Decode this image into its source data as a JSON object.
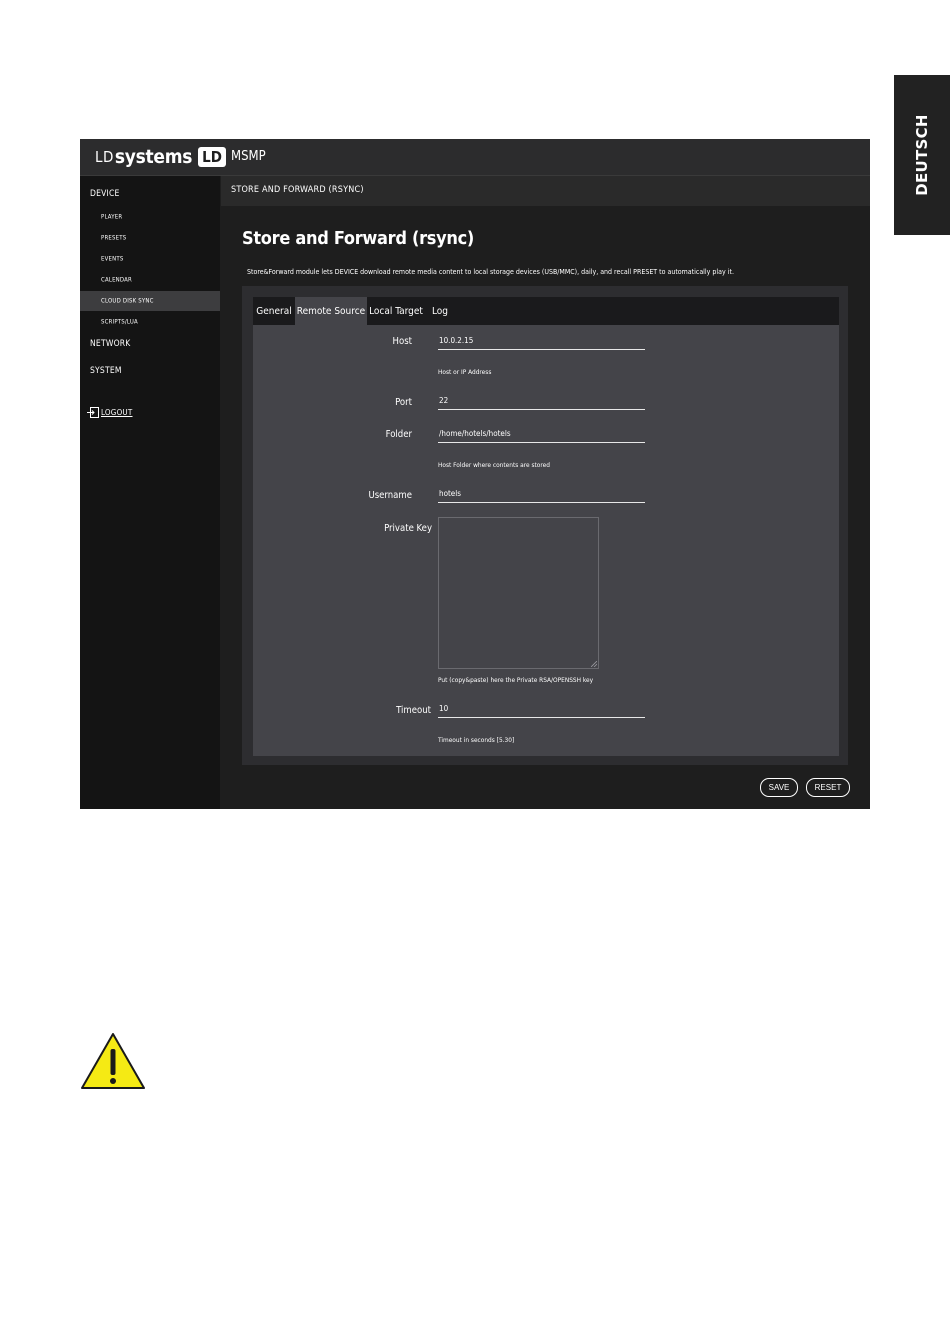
{
  "language_tab": "DEUTSCH",
  "app": {
    "logo": {
      "ld": "LD",
      "systems": "systems",
      "badge": "LD"
    },
    "name": "MSMP"
  },
  "sidebar": {
    "items": [
      {
        "label": "DEVICE",
        "type": "section"
      },
      {
        "label": "PLAYER",
        "type": "sub"
      },
      {
        "label": "PRESETS",
        "type": "sub"
      },
      {
        "label": "EVENTS",
        "type": "sub"
      },
      {
        "label": "CALENDAR",
        "type": "sub"
      },
      {
        "label": "CLOUD DISK SYNC",
        "type": "sub",
        "active": true
      },
      {
        "label": "SCRIPTS/LUA",
        "type": "sub"
      },
      {
        "label": "NETWORK",
        "type": "section"
      },
      {
        "label": "SYSTEM",
        "type": "section"
      }
    ],
    "logout": {
      "label": "LOGOUT",
      "icon": "logout-icon"
    }
  },
  "header": {
    "title": "STORE AND FORWARD (RSYNC)"
  },
  "page": {
    "title": "Store and Forward (rsync)",
    "description": "Store&Forward module lets DEVICE download remote media content to local storage devices (USB/MMC), daily, and recall PRESET to automatically play it."
  },
  "tabs": [
    {
      "label": "General",
      "active": false
    },
    {
      "label": "Remote Source",
      "active": true
    },
    {
      "label": "Local Target",
      "active": false
    },
    {
      "label": "Log",
      "active": false
    }
  ],
  "form": {
    "host": {
      "label": "Host",
      "value": "10.0.2.15",
      "hint": "Host or IP Address"
    },
    "port": {
      "label": "Port",
      "value": "22"
    },
    "folder": {
      "label": "Folder",
      "value": "/home/hotels/hotels",
      "hint": "Host Folder where contents are stored"
    },
    "username": {
      "label": "Username",
      "value": "hotels"
    },
    "private_key": {
      "label": "Private Key",
      "value": "",
      "hint": "Put (copy&paste) here the Private RSA/OPENSSH key"
    },
    "timeout": {
      "label": "Timeout",
      "value": "10",
      "hint": "Timeout in seconds [5.30]"
    }
  },
  "buttons": {
    "save": "SAVE",
    "reset": "RESET"
  },
  "colors": {
    "app_bg": "#1e1e1e",
    "sidebar_bg": "#141414",
    "form_bg": "#444449",
    "warning_yellow": "#f5ea14",
    "lang_tab_bg": "#222222"
  }
}
